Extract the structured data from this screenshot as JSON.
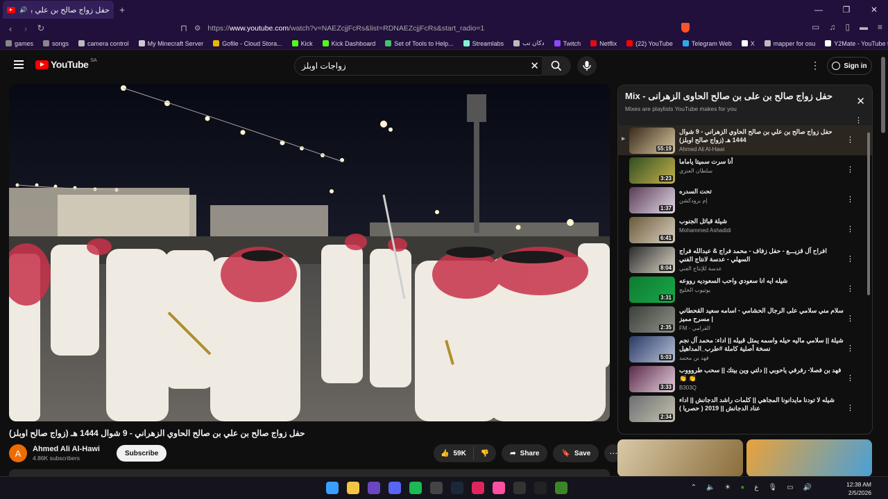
{
  "browser": {
    "tab_title": "حفل زواج صالح بن علي بن صالح الح",
    "url_scheme": "https://",
    "url_host": "www.youtube.com",
    "url_path": "/watch?v=NAEZcjjFcRs&list=RDNAEZcjjFcRs&start_radio=1",
    "bookmarks": [
      {
        "label": "games",
        "color": "#888888"
      },
      {
        "label": "songs",
        "color": "#888888"
      },
      {
        "label": "camera control",
        "color": "#bbbbbb"
      },
      {
        "label": "My Minecraft Server",
        "color": "#cccccc"
      },
      {
        "label": "Gofile - Cloud Stora...",
        "color": "#e6b800"
      },
      {
        "label": "Kick",
        "color": "#53fc18"
      },
      {
        "label": "Kick Dashboard",
        "color": "#53fc18"
      },
      {
        "label": "Set of Tools to Help...",
        "color": "#43c46b"
      },
      {
        "label": "Streamlabs",
        "color": "#80f5d2"
      },
      {
        "label": "دكان تب",
        "color": "#bbbbbb"
      },
      {
        "label": "Twitch",
        "color": "#9146ff"
      },
      {
        "label": "Netflix",
        "color": "#e50914"
      },
      {
        "label": "(22) YouTube",
        "color": "#ff0000"
      },
      {
        "label": "Telegram Web",
        "color": "#2aabee"
      },
      {
        "label": "X",
        "color": "#ffffff"
      },
      {
        "label": "mapper for osu",
        "color": "#bbbbbb"
      },
      {
        "label": "Y2Mate - YouTube t...",
        "color": "#ffffff"
      }
    ]
  },
  "youtube": {
    "logo_text": "YouTube",
    "country_code": "SA",
    "search_value": "زواجات اوبلز",
    "sign_in_label": "Sign in"
  },
  "video": {
    "title": "حفل زواج صالح بن علي بن صالح الحاوي الزهراني - 9 شوال 1444 هـ (زواج صالح اوبلز)",
    "channel_name": "Ahmed Ali Al-Hawi",
    "channel_initial": "A",
    "subscribers": "4.86K subscribers",
    "subscribe_label": "Subscribe",
    "likes": "59K",
    "share_label": "Share",
    "save_label": "Save"
  },
  "mix": {
    "title": "Mix - حفل زواج صالح بن على بن صالح الحاوى الزهرانى",
    "subtitle": "Mixes are playlists YouTube makes for you",
    "items": [
      {
        "title": "حفل زواج صالح بن علي بن صالح الحاوي الزهراني - 9 شوال 1444 هـ (زواج صالح اوبلز)",
        "channel": "Ahmed Ali Al-Hawi",
        "duration": "55:19",
        "colors": [
          "#3a2a1a",
          "#d8c7a0"
        ]
      },
      {
        "title": "أنا سرت سميتا ياماما",
        "channel": "سلطان العنزي",
        "duration": "3:23",
        "colors": [
          "#2f4d22",
          "#c7b24a"
        ]
      },
      {
        "title": "تحت السدره",
        "channel": "إم برودكشن",
        "duration": "1:37",
        "colors": [
          "#5a3b55",
          "#e3d9e8"
        ]
      },
      {
        "title": "شيلة قبائل الجنوب",
        "channel": "Mohammed Ashadidi",
        "duration": "6:41",
        "colors": [
          "#6b5a3a",
          "#d9d0c0"
        ]
      },
      {
        "title": "افراح آل قزيـــع - حفل زفاف - محمد فراج & عبدالله فراج السهلي - عدسة لانتاج الفني",
        "channel": "عدسة للإنتاج الفني",
        "duration": "8:04",
        "colors": [
          "#2b2b2b",
          "#dcd6c8"
        ]
      },
      {
        "title": "شيله ايه انا سعودي واحب السعوديه رووعه",
        "channel": "يوتيوب الخليج",
        "duration": "3:31",
        "colors": [
          "#0f7a2f",
          "#18a84a"
        ]
      },
      {
        "title": "سلام مني سلامي على الرجال الحشامي - اسامه سعيد القحطاني | مسرح مميز",
        "channel": "FM - القرامي",
        "duration": "2:35",
        "colors": [
          "#3b3f3a",
          "#8e9288"
        ]
      },
      {
        "title": "شيلة || سلامي ماليه حيله واسمه يمثل قبيله || اداء: محمد آل نجم نسخة أصلية كاملة #طرب_المداهيل",
        "channel": "فهد بن محمد",
        "duration": "5:03",
        "colors": [
          "#2a3a66",
          "#b9c2d8"
        ]
      },
      {
        "title": "فهد بن فصلا- رفرفي ياحوبي || دلتي وين بيتك || سحب طروووب 👏 👏",
        "channel": "B303Q",
        "duration": "3:33",
        "colors": [
          "#5a2b4a",
          "#e6cfdc"
        ]
      },
      {
        "title": "شيله لا تودنا مايدانونا المجاهي || كلمات راشد الدجانش || اداء عناد الدجانش || 2019 ( حصريا )",
        "channel": "",
        "duration": "2:34",
        "colors": [
          "#6b6f72",
          "#c7c2b0"
        ]
      }
    ]
  },
  "recommendations": [
    {
      "colors": [
        "#d9c9a8",
        "#8a6d3b"
      ]
    },
    {
      "colors": [
        "#e9a23b",
        "#4aa0d6"
      ]
    }
  ],
  "taskbar": {
    "time": "12:38 AM",
    "date": "2/5/2026",
    "lang": "ع",
    "apps": [
      {
        "name": "start",
        "color": "#3aa0ff"
      },
      {
        "name": "explorer",
        "color": "#f4c542"
      },
      {
        "name": "brave",
        "color": "#6b46c1"
      },
      {
        "name": "discord",
        "color": "#5865f2"
      },
      {
        "name": "spotify",
        "color": "#1db954"
      },
      {
        "name": "chrome",
        "color": "#444444"
      },
      {
        "name": "steam",
        "color": "#1b2838"
      },
      {
        "name": "app-red",
        "color": "#e0245e"
      },
      {
        "name": "app-pink",
        "color": "#ff4fa0"
      },
      {
        "name": "notes",
        "color": "#333333"
      },
      {
        "name": "app-circle",
        "color": "#222222"
      },
      {
        "name": "minecraft",
        "color": "#3c8527"
      }
    ]
  }
}
